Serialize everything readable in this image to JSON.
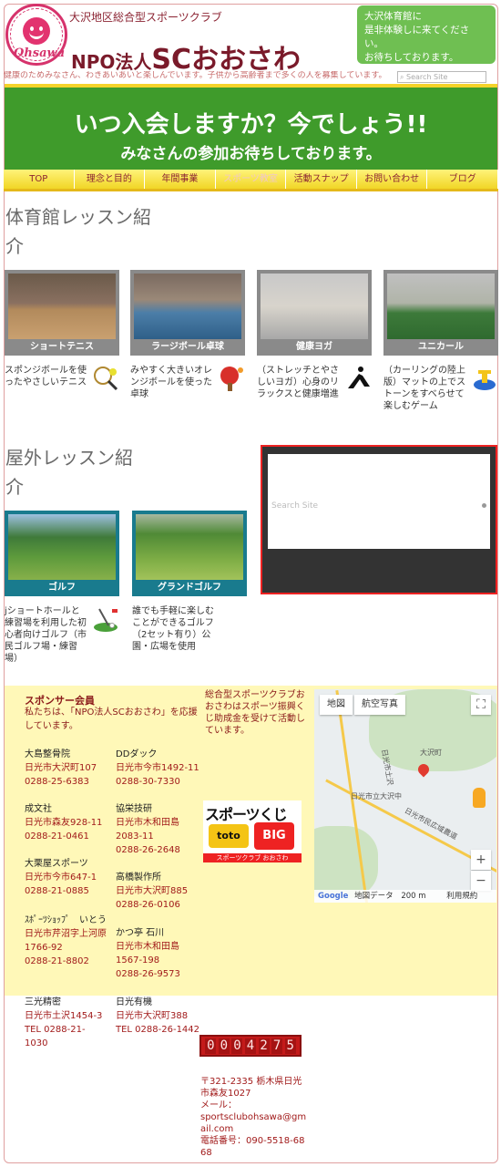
{
  "header": {
    "subtitle": "大沢地区総合型スポーツクラブ",
    "title_prefix": "NPO法人",
    "title_main": "SCおおさわ",
    "tagline": "健康のためみなさん、わきあいあいと楽しんでいます。子供から高齢者まで多くの人を募集しています。",
    "logo_text": "Ohsawa",
    "callout": [
      "大沢体育館に",
      "是非体験しに来てください。",
      "お待ちしております。"
    ],
    "search_placeholder": "Search Site"
  },
  "banner": {
    "line1": "いつ入会しますか？今でしょう!!",
    "line2": "みなさんの参加お待ちしております。"
  },
  "nav": [
    "TOP",
    "理念と目的",
    "年間事業",
    "スポーツ教室",
    "活動スナップ",
    "お問い合わせ",
    "ブログ"
  ],
  "gym": {
    "heading_1": "体育館レッスン紹",
    "heading_2": "介",
    "cards": [
      {
        "label": "ショートテニス",
        "desc": "スポンジボールを使ったやさしいテニス"
      },
      {
        "label": "ラージボール卓球",
        "desc": "みやすく大きいオレンジボールを使った卓球"
      },
      {
        "label": "健康ヨガ",
        "desc": "（ストレッチとやさしいヨガ）心身のリラックスと健康増進"
      },
      {
        "label": "ユニカール",
        "desc": "（カーリングの陸上版）マットの上でストーンをすべらせて楽しむゲーム"
      }
    ]
  },
  "outdoor": {
    "heading_1": "屋外レッスン紹",
    "heading_2": "介",
    "cards": [
      {
        "label": "ゴルフ",
        "desc": "jショートホールと練習場を利用した初心者向けゴルフ（市民ゴルフ場・練習場）"
      },
      {
        "label": "グランドゴルフ",
        "desc": "誰でも手軽に楽しむことができるゴルフ（2セット有り）公園・広場を使用"
      }
    ],
    "search_placeholder": "Search Site"
  },
  "footer": {
    "sponsor_title": "スポンサー会員",
    "sponsor_intro": "私たちは、「NPO法人SCおおさわ」を応援しています。",
    "toto_text": "総合型スポーツクラブおおさわはスポーツ振興くじ助成金を受けて活動しています。",
    "toto_logo": {
      "title": "スポーツくじ",
      "a": "toto",
      "b": "BIG",
      "foot": "スポーツクラブ おおさわ"
    },
    "sponsors": [
      {
        "name": "大島整骨院",
        "addr": "日光市大沢町107",
        "tel": "0288-25-6383"
      },
      {
        "name": "DDダック",
        "addr": "日光市今市1492-11",
        "tel": "0288-30-7330"
      },
      {
        "name": "成文社",
        "addr": "日光市森友928-11",
        "tel": "0288-21-0461"
      },
      {
        "name": "協栄技研",
        "addr": "日光市木和田島2083-11",
        "tel": "0288-26-2648"
      },
      {
        "name": "大栗屋スポーツ",
        "addr": "日光市今市647-1",
        "tel": "0288-21-0885"
      },
      {
        "name": "高橋製作所",
        "addr": "日光市大沢町885",
        "tel": "0288-26-0106"
      },
      {
        "name": "ｽﾎﾟｰﾂｼｮｯﾌﾟ　いとう",
        "addr": "日光市芹沼字上河原1766-92",
        "tel": "0288-21-8802"
      },
      {
        "name": "かつ亭 石川",
        "addr": "日光市木和田島1567-198",
        "tel": "0288-26-9573"
      },
      {
        "name": "三光精密",
        "addr": "日光市土沢1454-3",
        "tel": "TEL 0288-21-1030"
      },
      {
        "name": "日光有機",
        "addr": "日光市大沢町388",
        "tel": "TEL 0288-26-1442"
      }
    ],
    "map": {
      "tab_map": "地図",
      "tab_satellite": "航空写真",
      "zoom_in": "+",
      "zoom_out": "−",
      "fullscreen": "⛶",
      "place_1": "大沢町",
      "place_2": "日光市立大沢中",
      "place_3": "日光市民広域農道",
      "place_4": "日光市土沢",
      "google": "Google",
      "attribution": "地図データ",
      "scale": "200 m",
      "terms": "利用規約"
    },
    "counter": [
      "0",
      "0",
      "0",
      "4",
      "2",
      "7",
      "5"
    ],
    "address": "〒321-2335 栃木県日光市森友1027",
    "mail_label": "メール：",
    "mail": "sportsclubohsawa@gmail.com",
    "phone": "電話番号：090-5518-6868"
  },
  "colors": {
    "accent": "#3f9b2b",
    "brand": "#7a1a2a",
    "nav": "#f4e03a"
  }
}
